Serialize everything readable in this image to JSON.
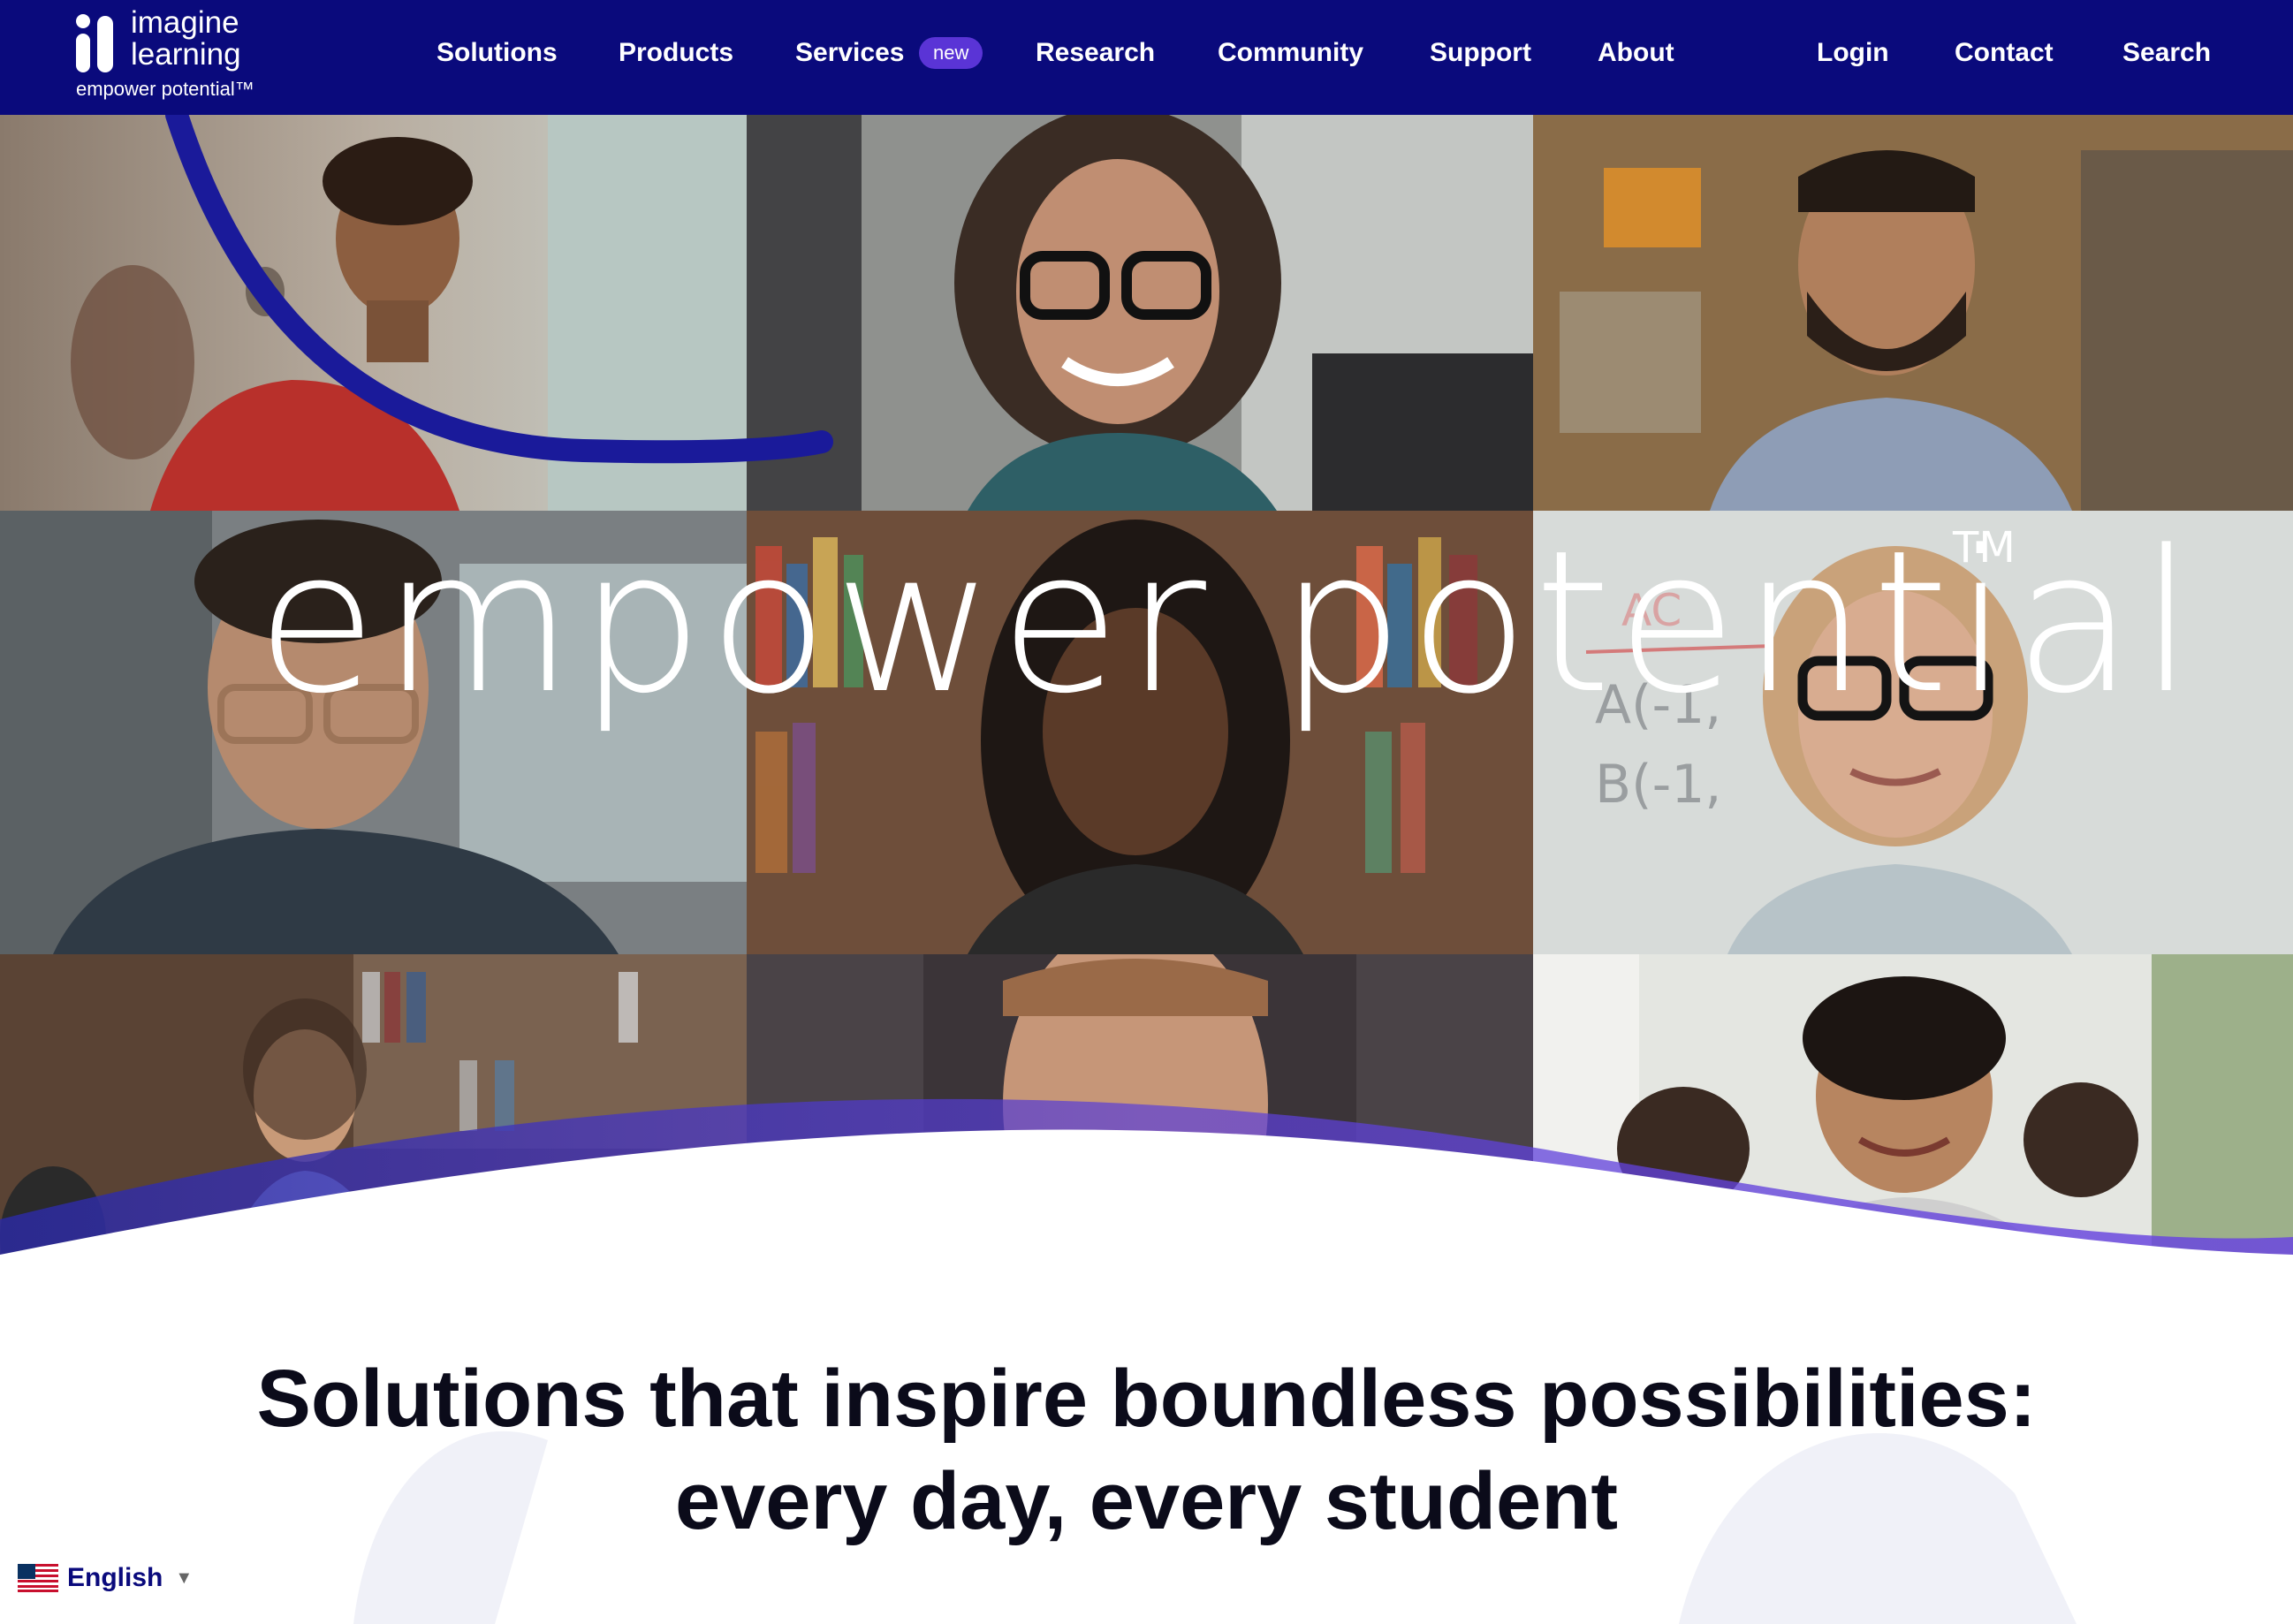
{
  "brand": {
    "line1": "imagine",
    "line2": "learning",
    "tagline": "empower potential™",
    "nav_color": "#0a0a7c",
    "accent": "#5a34d6"
  },
  "nav": {
    "items": [
      "Solutions",
      "Products",
      "Services",
      "Research",
      "Community",
      "Support",
      "About"
    ],
    "services_badge": "new",
    "utility": [
      "Login",
      "Contact",
      "Search"
    ]
  },
  "hero": {
    "tagline": "empower potential",
    "trademark": "TM"
  },
  "headline": {
    "line1": "Solutions that inspire boundless possibilities:",
    "line2": "every day, every student"
  },
  "language": {
    "label": "English",
    "flag_icon": "us-flag-icon",
    "caret_icon": "caret-down-icon"
  }
}
